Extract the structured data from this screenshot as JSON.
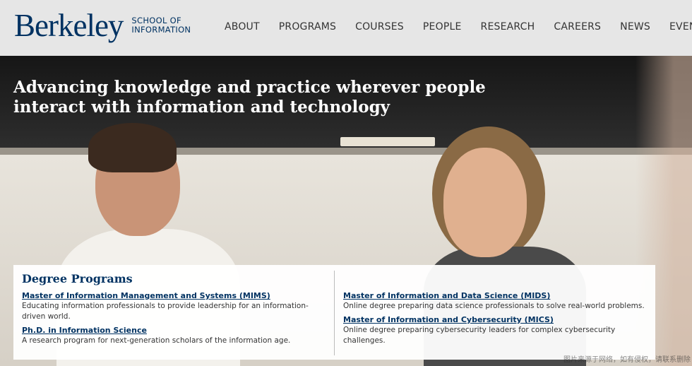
{
  "header": {
    "logo_word": "Berkeley",
    "logo_sub_1": "SCHOOL OF",
    "logo_sub_2": "INFORMATION",
    "nav": [
      "About",
      "Programs",
      "Courses",
      "People",
      "Research",
      "Careers",
      "News",
      "Events"
    ]
  },
  "hero": {
    "tagline": "Advancing knowledge and practice wherever people interact with information and technology"
  },
  "degrees": {
    "heading": "Degree Programs",
    "left": [
      {
        "title": "Master of Information Management and Systems (MIMS)",
        "desc": "Educating information professionals to provide leadership for an information-driven world."
      },
      {
        "title": "Ph.D. in Information Science",
        "desc": "A research program for next-generation scholars of the information age."
      }
    ],
    "right": [
      {
        "title": "Master of Information and Data Science (MIDS)",
        "desc": "Online degree preparing data science professionals to solve real-world problems."
      },
      {
        "title": "Master of Information and Cybersecurity (MICS)",
        "desc": "Online degree preparing cybersecurity leaders for complex cybersecurity challenges."
      }
    ]
  },
  "watermark": "图片来源于网络，如有侵权，请联系删除",
  "colors": {
    "brand": "#003262",
    "header_bg": "#e6e6e6"
  }
}
